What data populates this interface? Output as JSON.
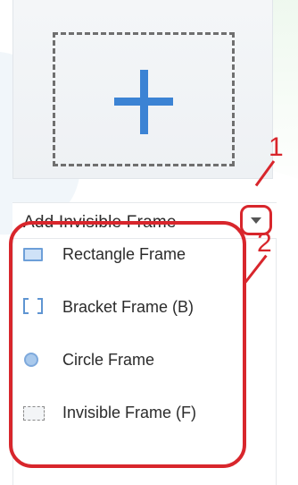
{
  "add_frame": {
    "icon": "plus-icon"
  },
  "annotations": {
    "step1": "1",
    "step2": "2"
  },
  "dropdown": {
    "label": "Add Invisible Frame",
    "arrow_icon": "chevron-down-icon"
  },
  "menu": {
    "items": [
      {
        "label": "Rectangle Frame",
        "icon": "rectangle-frame-icon"
      },
      {
        "label": "Bracket Frame (B)",
        "icon": "bracket-frame-icon"
      },
      {
        "label": "Circle Frame",
        "icon": "circle-frame-icon"
      },
      {
        "label": "Invisible Frame (F)",
        "icon": "invisible-frame-icon"
      }
    ]
  },
  "colors": {
    "annotation_red": "#d8262c",
    "plus_blue": "#3c83d4",
    "icon_blue": "#6d9fd8"
  }
}
